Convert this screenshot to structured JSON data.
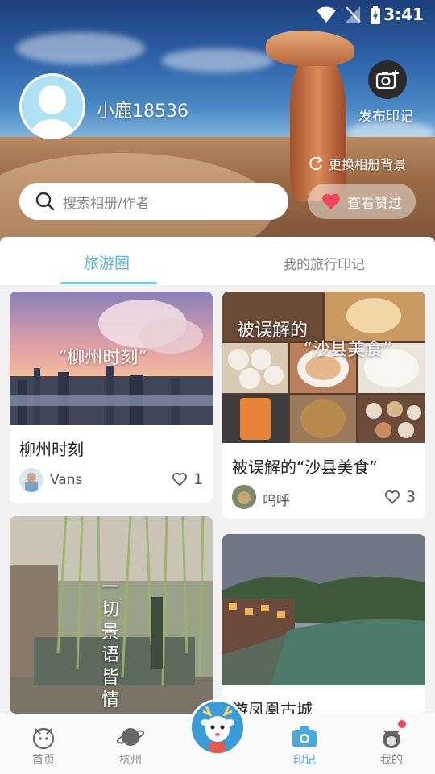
{
  "status": {
    "time": "3:41"
  },
  "profile": {
    "username": "小鹿18536",
    "publish_label": "发布印记",
    "change_bg_label": "更换相册背景",
    "search_placeholder": "搜索相册/作者",
    "likes_label": "查看赞过"
  },
  "tabs": [
    {
      "label": "旅游圈",
      "active": true
    },
    {
      "label": "我的旅行印记",
      "active": false
    }
  ],
  "cards": [
    {
      "title": "柳州时刻",
      "overlay": "“柳州时刻”",
      "author": "Vans",
      "likes": "1"
    },
    {
      "title": "被误解的“沙县美食”",
      "overlay_line1": "被误解的",
      "overlay_line2": "“沙县美食”",
      "author": "呜呼",
      "likes": "3"
    },
    {
      "title": "",
      "overlay_chars": [
        "一",
        "切",
        "景",
        "语",
        "皆",
        "情"
      ]
    },
    {
      "title": "游凤凰古城"
    }
  ],
  "nav": [
    {
      "label": "首页",
      "icon": "mascot-head-icon",
      "active": false
    },
    {
      "label": "杭州",
      "icon": "planet-icon",
      "active": false
    },
    {
      "label": "",
      "icon": "deer-mascot-icon",
      "active": false
    },
    {
      "label": "印记",
      "icon": "camera-icon",
      "active": true
    },
    {
      "label": "我的",
      "icon": "profile-mascot-icon",
      "active": false
    }
  ],
  "colors": {
    "accent": "#5fb4d8",
    "like_heart": "#f0465a",
    "nav_active": "#4aa8dc"
  }
}
